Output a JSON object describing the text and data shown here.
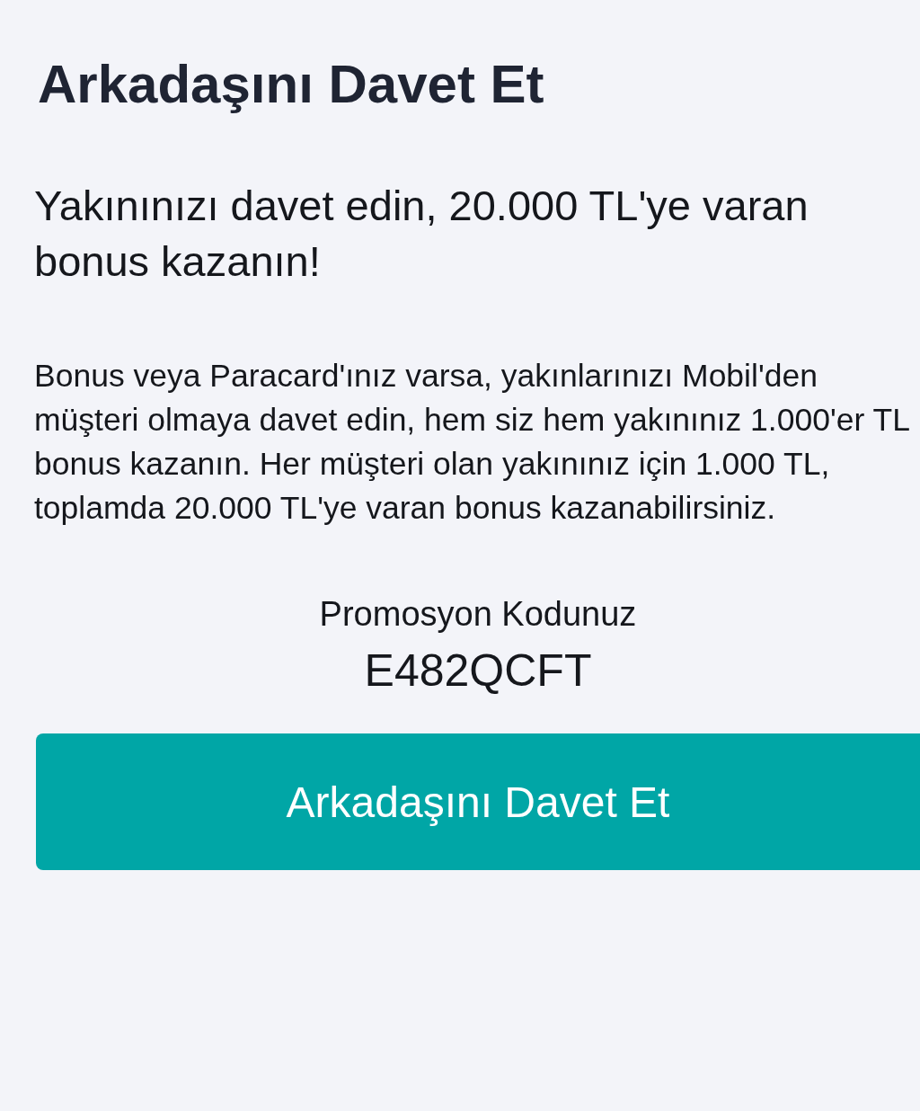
{
  "title": "Arkadaşını Davet Et",
  "headline": "Yakınınızı davet edin, 20.000 TL'ye varan bonus kazanın!",
  "description": "Bonus veya Paracard'ınız varsa, yakınlarınızı Mobil'den müşteri olmaya davet edin, hem siz hem yakınınız 1.000'er TL bonus kazanın. Her müşteri olan yakınınız için 1.000 TL, toplamda 20.000 TL'ye varan bonus kazanabilirsiniz.",
  "promo": {
    "label": "Promosyon Kodunuz",
    "code": "E482QCFT"
  },
  "button": {
    "label": "Arkadaşını Davet Et"
  }
}
